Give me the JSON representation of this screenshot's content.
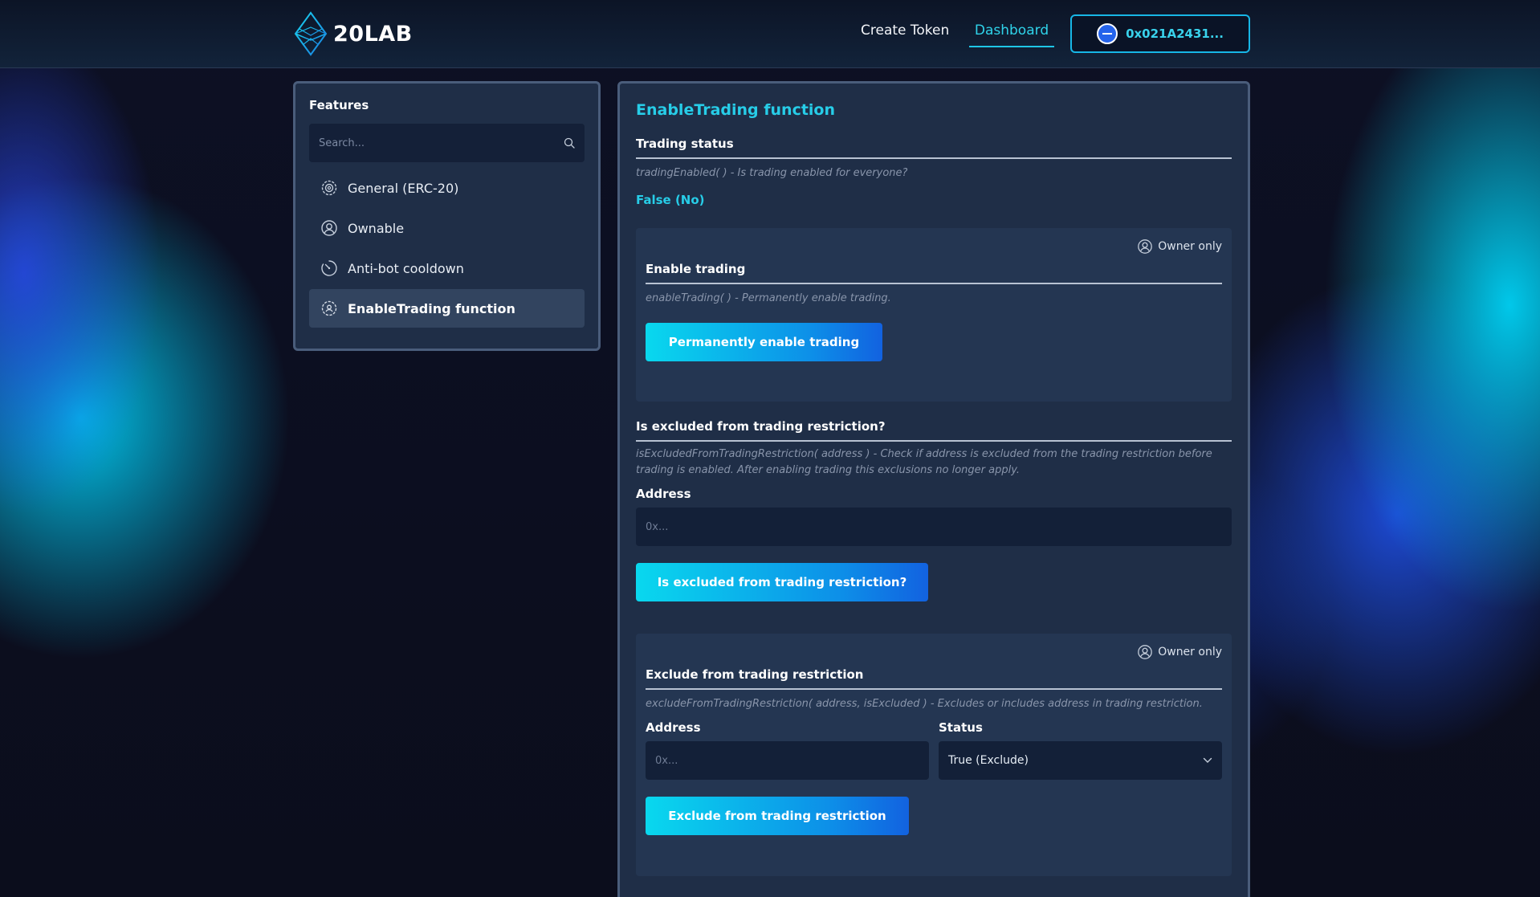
{
  "brand": {
    "name": "20LAB"
  },
  "nav": {
    "create_token": "Create Token",
    "dashboard": "Dashboard",
    "wallet_address": "0x021A2431..."
  },
  "sidebar": {
    "title": "Features",
    "search_placeholder": "Search...",
    "items": [
      {
        "label": "General (ERC-20)",
        "icon": "gear-icon",
        "active": false
      },
      {
        "label": "Ownable",
        "icon": "user-circle-icon",
        "active": false
      },
      {
        "label": "Anti-bot cooldown",
        "icon": "timer-icon",
        "active": false
      },
      {
        "label": "EnableTrading function",
        "icon": "gear-users-icon",
        "active": true
      }
    ]
  },
  "main": {
    "title": "EnableTrading function",
    "trading_status": {
      "label": "Trading status",
      "description": "tradingEnabled( ) - Is trading enabled for everyone?",
      "value": "False (No)"
    },
    "enable_trading": {
      "owner_label": "Owner only",
      "label": "Enable trading",
      "description": "enableTrading( ) - Permanently enable trading.",
      "button": "Permanently enable trading"
    },
    "is_excluded": {
      "label": "Is excluded from trading restriction?",
      "description": "isExcludedFromTradingRestriction( address ) - Check if address is excluded from the trading restriction before trading is enabled. After enabling trading this exclusions no longer apply.",
      "address_label": "Address",
      "address_placeholder": "0x...",
      "button": "Is excluded from trading restriction?"
    },
    "exclude": {
      "owner_label": "Owner only",
      "label": "Exclude from trading restriction",
      "description": "excludeFromTradingRestriction( address, isExcluded ) - Excludes or includes address in trading restriction.",
      "address_label": "Address",
      "address_placeholder": "0x...",
      "status_label": "Status",
      "status_value": "True (Exclude)",
      "button": "Exclude from trading restriction"
    }
  },
  "colors": {
    "accent": "#27cde8",
    "panel": "#1f2e47",
    "panel_border": "#4a5d7b",
    "button_start": "#09d8ee",
    "button_end": "#1262e0"
  }
}
